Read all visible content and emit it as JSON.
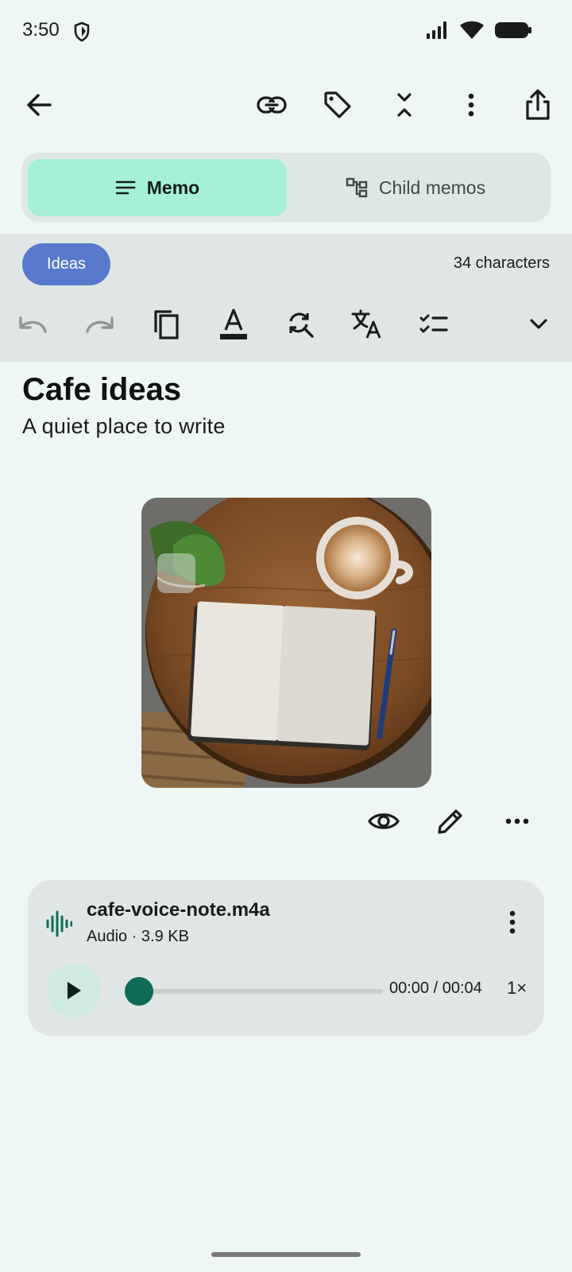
{
  "status_bar": {
    "time": "3:50",
    "icons": [
      "shield-icon",
      "signal-icon",
      "wifi-icon",
      "battery-icon"
    ]
  },
  "toolbar": {
    "icons": [
      "back-arrow-icon",
      "link-icon",
      "tag-icon",
      "collapse-icon",
      "more-vert-icon",
      "share-icon"
    ]
  },
  "tabs": {
    "memo_label": "Memo",
    "child_label": "Child memos",
    "active": "Memo"
  },
  "tag": {
    "label": "Ideas",
    "color": "#5879cc"
  },
  "char_count": "34 characters",
  "format_toolbar": {
    "icons": [
      "undo-icon",
      "redo-icon",
      "copy-icon",
      "text-color-icon",
      "find-replace-icon",
      "translate-icon",
      "checklist-icon",
      "expand-icon"
    ]
  },
  "memo": {
    "title": "Cafe ideas",
    "subtitle": "A quiet place to write"
  },
  "image_actions": {
    "icons": [
      "eye-icon",
      "edit-pencil-icon",
      "more-horiz-icon"
    ]
  },
  "audio": {
    "filename": "cafe-voice-note.m4a",
    "meta": "Audio · 3.9 KB",
    "time": "00:00 / 00:04",
    "speed": "1×",
    "progress": 0.0
  },
  "colors": {
    "background": "#eef7f5",
    "accent": "#0f6b57",
    "tab_active": "#a6f0d9"
  }
}
